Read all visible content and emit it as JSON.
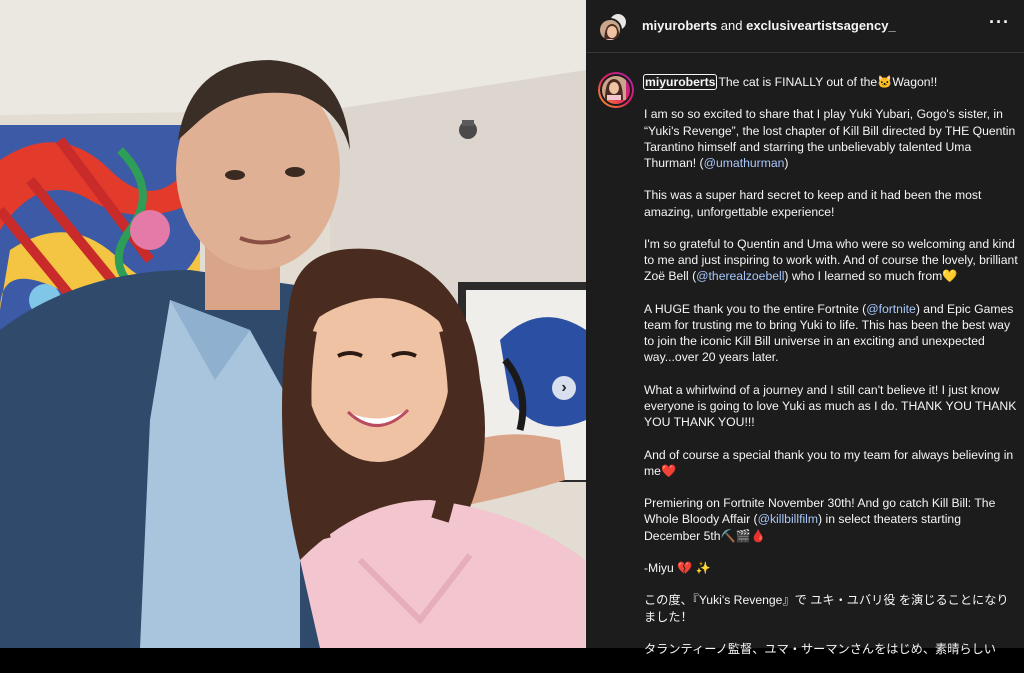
{
  "post": {
    "header": {
      "user1": "miyuroberts",
      "and": "and",
      "user2": "exclusiveartistsagency_",
      "more": "···"
    },
    "carousel_next": "›",
    "caption": {
      "username": "miyuroberts",
      "line1_text": "The cat is FINALLY out of the",
      "line1_emoji": "🐱",
      "line1_end": "Wagon!!",
      "p1": {
        "a": "I am so so excited to share that I play Yuki Yubari, Gogo's sister, in “Yuki's Revenge”, the lost chapter of Kill Bill directed by THE Quentin Tarantino himself and starring the unbelievably talented Uma Thurman! (",
        "mention": "@umathurman",
        "b": ")"
      },
      "p2": "This was a super hard secret to keep and it had been the most amazing, unforgettable experience!",
      "p3": {
        "a": "I'm so grateful to Quentin and Uma who were so welcoming and kind to me and just inspiring to work with. And of course the lovely, brilliant Zoë Bell (",
        "mention": "@therealzoebell",
        "b": ") who I learned so much from",
        "emoji": "💛"
      },
      "p4": {
        "a": "A HUGE thank you to the entire Fortnite (",
        "mention": "@fortnite",
        "b": ") and Epic Games team for trusting me to bring Yuki to life. This has been the best way to join the iconic Kill Bill universe in an exciting and unexpected way...over 20 years later."
      },
      "p5": "What a whirlwind of a journey and I still can't believe it! I just know everyone is going to love Yuki as much as I do. THANK YOU THANK YOU THANK YOU!!!",
      "p6": {
        "a": "And of course a special thank you to my team for always believing in me",
        "emoji": "❤️"
      },
      "p7": {
        "a": "Premiering on Fortnite November 30th! And go catch Kill Bill: The Whole Bloody Affair (",
        "mention": "@killbillfilm",
        "b": ") in select theaters starting December 5th",
        "emoji": "⛏️🎬🩸"
      },
      "p8": {
        "a": "-Miyu",
        "emoji": "💔 ✨"
      },
      "jp1": "この度、『Yuki's Revenge』で ユキ・ユバリ役 を演じることになりました！",
      "jp2": "タランティーノ監督、ユマ・サーマンさんをはじめ、素晴らしい"
    }
  },
  "colors": {
    "panel_bg": "#1c1c1c",
    "text": "#f5f5f5",
    "mention": "#a8c7fa"
  }
}
